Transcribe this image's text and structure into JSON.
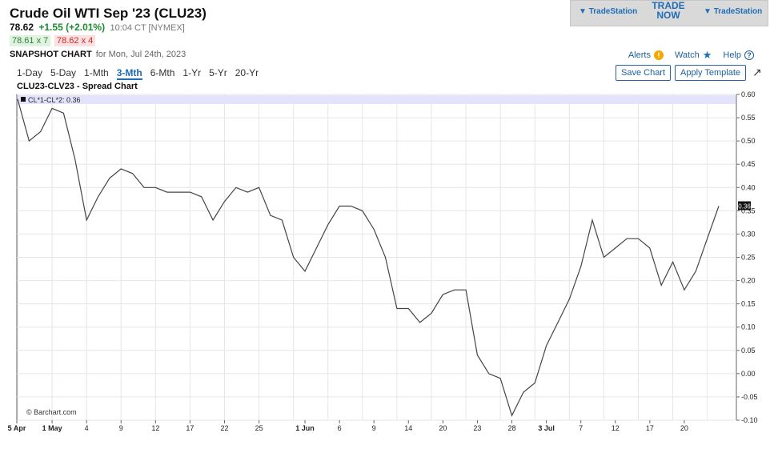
{
  "header": {
    "title": "Crude Oil WTI Sep '23 (CLU23)",
    "last_price": "78.62",
    "change": "+1.55 (+2.01%)",
    "time": "10:04 CT [NYMEX]",
    "bid": "78.61 x 7",
    "ask": "78.62 x 4",
    "snapshot_label": "SNAPSHOT CHART",
    "snapshot_date": "for Mon, Jul 24th, 2023"
  },
  "ad": {
    "logo_left": "TradeStation",
    "cta_line1": "TRADE",
    "cta_line2": "NOW",
    "logo_right": "TradeStation"
  },
  "toolbar": {
    "alerts": "Alerts",
    "alerts_icon": "!",
    "watch": "Watch",
    "help": "Help",
    "help_icon": "?",
    "save_chart": "Save Chart",
    "apply_template": "Apply Template"
  },
  "period_tabs": [
    "1-Day",
    "5-Day",
    "1-Mth",
    "3-Mth",
    "6-Mth",
    "1-Yr",
    "5-Yr",
    "20-Yr"
  ],
  "active_tab": "3-Mth",
  "colors": {
    "accent": "#1f6db5",
    "positive": "#1a8a2e",
    "legend_bar": "#e3e3fb",
    "line": "#444444"
  },
  "chart_data": {
    "type": "line",
    "title": "CLU23-CLV23 - Spread Chart",
    "legend": "CL*1-CL*2: 0.36",
    "watermark": "© Barchart.com",
    "last_value_label": "0.36",
    "ylim": [
      -0.1,
      0.6
    ],
    "yticks": [
      "0.60",
      "0.55",
      "0.50",
      "0.45",
      "0.40",
      "0.35",
      "0.30",
      "0.25",
      "0.20",
      "0.15",
      "0.10",
      "0.05",
      "0.00",
      "-0.05",
      "-0.10"
    ],
    "x_ticks": [
      {
        "label": "5 Apr",
        "i": 0,
        "bold": true
      },
      {
        "label": "1 May",
        "i": 3,
        "bold": true
      },
      {
        "label": "4",
        "i": 6
      },
      {
        "label": "9",
        "i": 9
      },
      {
        "label": "12",
        "i": 12
      },
      {
        "label": "17",
        "i": 15
      },
      {
        "label": "22",
        "i": 18
      },
      {
        "label": "25",
        "i": 21
      },
      {
        "label": "1 Jun",
        "i": 25,
        "bold": true
      },
      {
        "label": "6",
        "i": 28
      },
      {
        "label": "9",
        "i": 31
      },
      {
        "label": "14",
        "i": 34
      },
      {
        "label": "20",
        "i": 37
      },
      {
        "label": "23",
        "i": 40
      },
      {
        "label": "28",
        "i": 43
      },
      {
        "label": "3 Jul",
        "i": 46,
        "bold": true
      },
      {
        "label": "7",
        "i": 49
      },
      {
        "label": "12",
        "i": 52
      },
      {
        "label": "17",
        "i": 55
      },
      {
        "label": "20",
        "i": 58
      }
    ],
    "series": [
      {
        "values": [
          0.59,
          0.5,
          0.52,
          0.57,
          0.56,
          0.46,
          0.33,
          0.38,
          0.42,
          0.44,
          0.43,
          0.4,
          0.4,
          0.39,
          0.39,
          0.39,
          0.38,
          0.33,
          0.37,
          0.4,
          0.39,
          0.4,
          0.34,
          0.33,
          0.25,
          0.22,
          0.27,
          0.32,
          0.36,
          0.36,
          0.35,
          0.31,
          0.25,
          0.14,
          0.14,
          0.11,
          0.13,
          0.17,
          0.18,
          0.18,
          0.04,
          0.0,
          -0.01,
          -0.09,
          -0.04,
          -0.02,
          0.06,
          0.11,
          0.16,
          0.23,
          0.33,
          0.25,
          0.27,
          0.29,
          0.29,
          0.27,
          0.19,
          0.24,
          0.18,
          0.22,
          0.29,
          0.36
        ]
      }
    ]
  }
}
